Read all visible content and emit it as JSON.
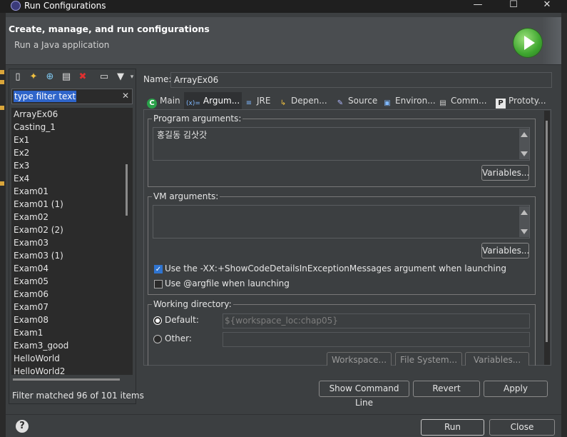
{
  "window": {
    "title": "Run Configurations",
    "minimize": "—",
    "maximize": "☐",
    "close": "✕"
  },
  "header": {
    "title": "Create, manage, and run configurations",
    "subtitle": "Run a Java application"
  },
  "sidebar": {
    "toolbar": [
      "new-config-icon",
      "new-prototype-icon",
      "duplicate-icon",
      "export-icon",
      "delete-icon",
      "collapse-all-icon",
      "filter-icon"
    ],
    "filter_text": "type filter text",
    "clear": "✕",
    "items": [
      "ArrayEx06",
      "Casting_1",
      "Ex1",
      "Ex2",
      "Ex3",
      "Ex4",
      "Exam01",
      "Exam01 (1)",
      "Exam02",
      "Exam02 (2)",
      "Exam03",
      "Exam03 (1)",
      "Exam04",
      "Exam05",
      "Exam06",
      "Exam07",
      "Exam08",
      "Exam1",
      "Exam3_good",
      "HelloWorld",
      "HelloWorld2"
    ],
    "matched": "Filter matched 96 of 101 items"
  },
  "config": {
    "name_label": "Name:",
    "name_value": "ArrayEx06",
    "tabs": [
      {
        "label": "Main",
        "icon": "C"
      },
      {
        "label": "Argum...",
        "icon": "(x)="
      },
      {
        "label": "JRE",
        "icon": "≡"
      },
      {
        "label": "Depen...",
        "icon": "↳"
      },
      {
        "label": "Source",
        "icon": "✎"
      },
      {
        "label": "Environ...",
        "icon": "▣"
      },
      {
        "label": "Comm...",
        "icon": "▤"
      },
      {
        "label": "Prototy...",
        "icon": "P"
      }
    ],
    "program_args": {
      "label": "Program arguments:",
      "value": "홍길동 김삿갓",
      "variables": "Variables..."
    },
    "vm_args": {
      "label": "VM arguments:",
      "value": "",
      "variables": "Variables..."
    },
    "check_show_details": "Use the -XX:+ShowCodeDetailsInExceptionMessages argument when launching",
    "check_argfile": "Use @argfile when launching",
    "working_dir": {
      "label": "Working directory:",
      "default_label": "Default:",
      "default_value": "${workspace_loc:chap05}",
      "other_label": "Other:",
      "other_value": "",
      "workspace": "Workspace...",
      "file_system": "File System...",
      "variables": "Variables..."
    },
    "show_command_line": "Show Command Line",
    "revert": "Revert",
    "apply": "Apply"
  },
  "footer": {
    "help": "?",
    "run": "Run",
    "close": "Close"
  }
}
